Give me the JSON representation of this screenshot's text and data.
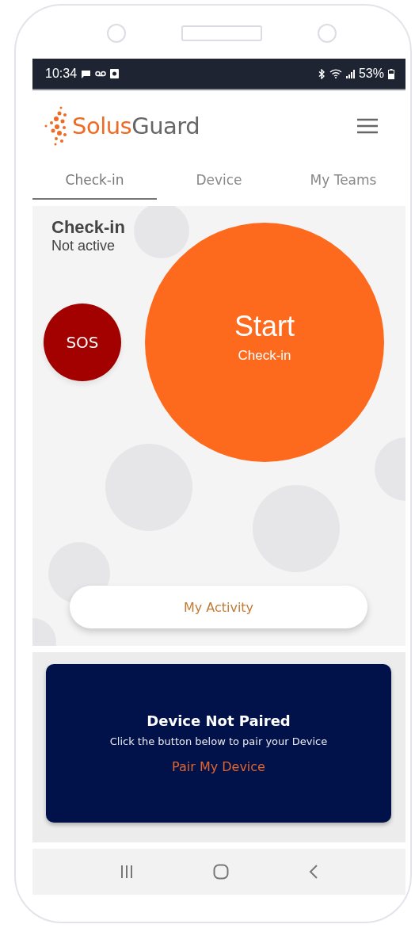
{
  "status_bar": {
    "time": "10:34",
    "battery": "53%"
  },
  "header": {
    "logo_primary": "Solus",
    "logo_secondary": "Guard"
  },
  "tabs": [
    {
      "label": "Check-in",
      "selected": true
    },
    {
      "label": "Device",
      "selected": false
    },
    {
      "label": "My Teams",
      "selected": false
    }
  ],
  "checkin": {
    "title": "Check-in",
    "status": "Not active",
    "sos_label": "SOS",
    "start_label": "Start",
    "start_sublabel": "Check-in",
    "activity_button": "My Activity"
  },
  "device_card": {
    "title": "Device Not Paired",
    "message": "Click the button below to pair your Device",
    "action": "Pair My Device"
  }
}
